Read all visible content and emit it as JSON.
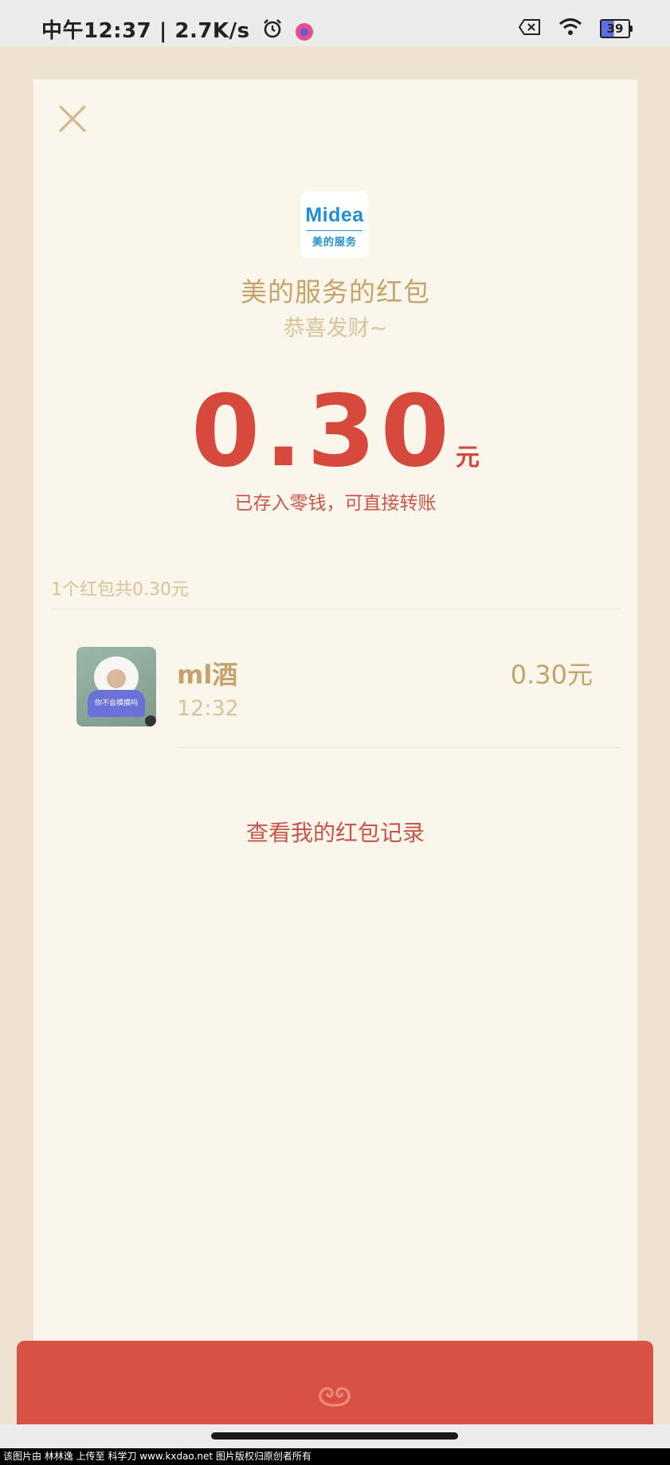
{
  "status_bar": {
    "time_speed": "中午12:37 | 2.7K/s",
    "battery": "39",
    "icons": [
      "alarm-icon",
      "app-notification-icon",
      "sim-x-icon",
      "wifi-icon",
      "battery-icon"
    ]
  },
  "envelope": {
    "logo_word": "Midea",
    "logo_sub": "美的服务",
    "sender_title": "美的服务的红包",
    "greeting": "恭喜发财~",
    "amount": "0.30",
    "unit": "元",
    "stored_note": "已存入零钱，可直接转账",
    "summary": "1个红包共0.30元"
  },
  "receivers": [
    {
      "name": "ml酒",
      "time": "12:32",
      "amount": "0.30元",
      "avatar_text": "你不会摸摸吗"
    }
  ],
  "records_link": "查看我的红包记录",
  "watermark": "该图片由 林林逸 上传至 科学刀 www.kxdao.net 图片版权归原创者所有",
  "colors": {
    "accent_red": "#d6493c",
    "gold_text": "#c4a46b",
    "card_bg": "#faf6eb",
    "page_bg": "#ede3d0",
    "envelope_red": "#d95044"
  }
}
